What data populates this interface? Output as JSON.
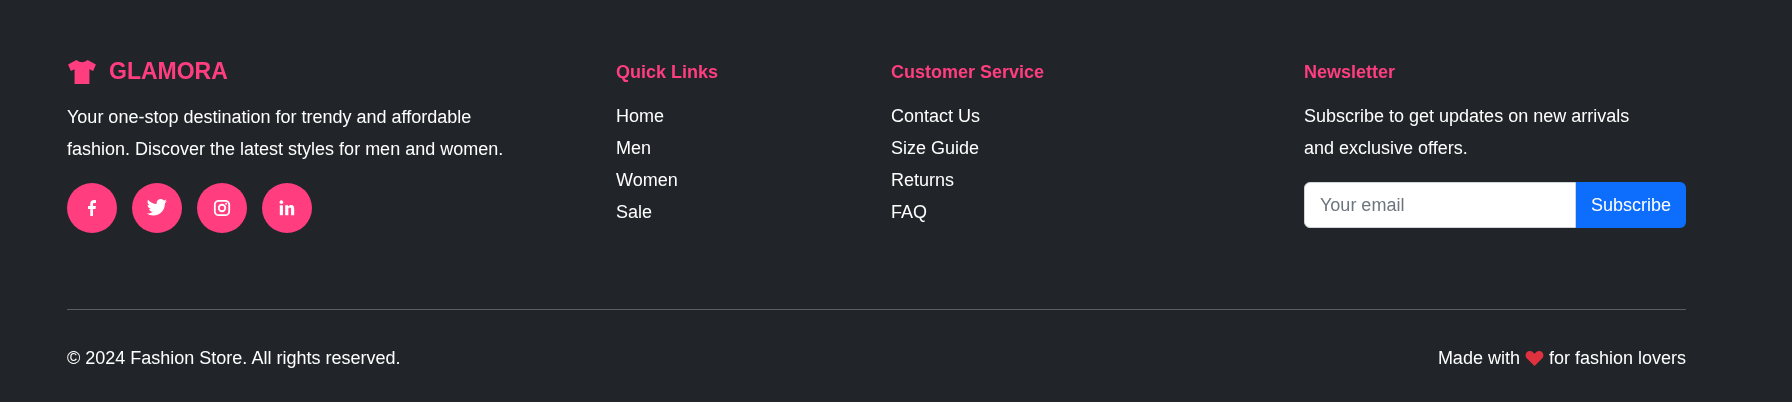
{
  "brand": {
    "name": "GLAMORA",
    "description": "Your one-stop destination for trendy and affordable fashion. Discover the latest styles for men and women.",
    "social": [
      {
        "kind": "facebook"
      },
      {
        "kind": "twitter"
      },
      {
        "kind": "instagram"
      },
      {
        "kind": "linkedin"
      }
    ]
  },
  "columns": [
    {
      "title": "Quick Links",
      "links": [
        "Home",
        "Men",
        "Women",
        "Sale"
      ]
    },
    {
      "title": "Customer Service",
      "links": [
        "Contact Us",
        "Size Guide",
        "Returns",
        "FAQ"
      ]
    }
  ],
  "newsletter": {
    "title": "Newsletter",
    "text": "Subscribe to get updates on new arrivals and exclusive offers.",
    "placeholder": "Your email",
    "button": "Subscribe"
  },
  "bottom": {
    "copyright": "© 2024 Fashion Store. All rights reserved.",
    "made_before": "Made with",
    "made_after": "for fashion lovers"
  }
}
